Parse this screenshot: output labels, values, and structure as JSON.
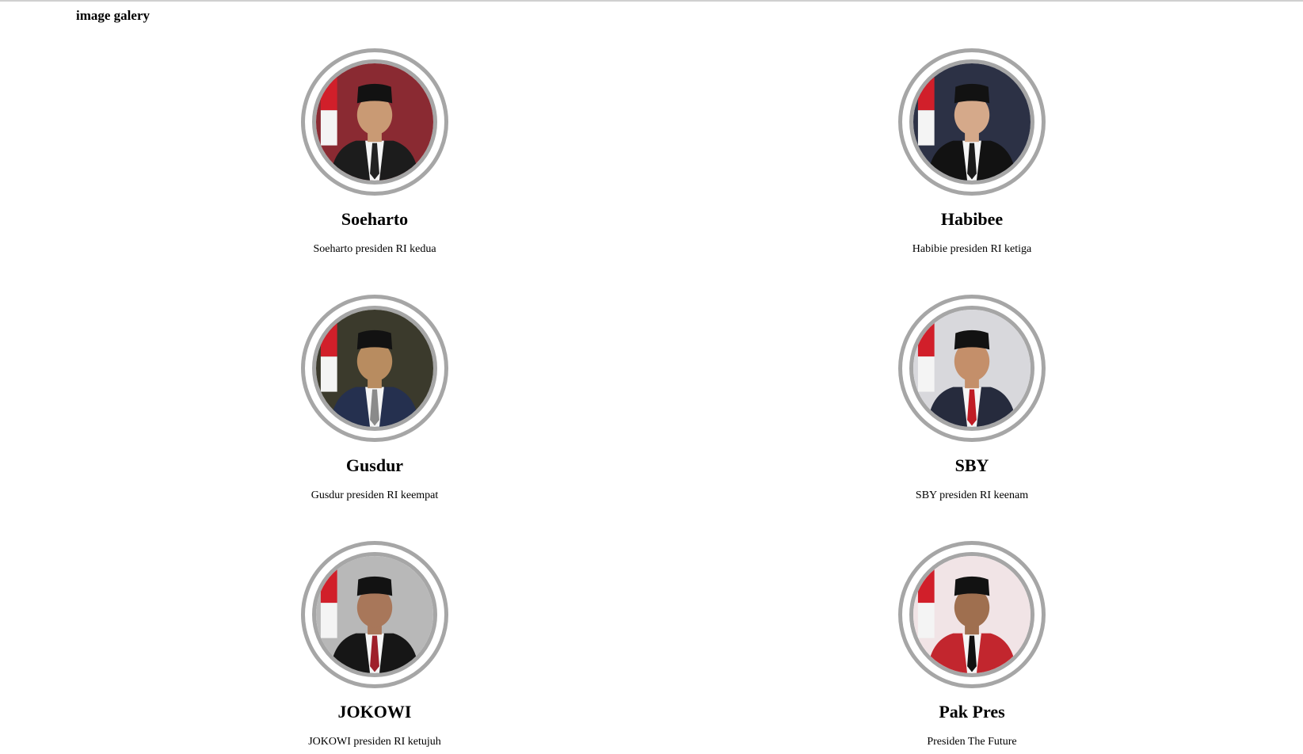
{
  "page": {
    "title": "image galery"
  },
  "gallery": [
    {
      "name": "Soeharto",
      "caption": "Soeharto presiden RI kedua",
      "photo": "portrait-soeharto",
      "bg": "#8a2a32",
      "suit": "#1c1c1c",
      "tie": "#222222",
      "skin": "#c99a74"
    },
    {
      "name": "Habibee",
      "caption": "Habibie presiden RI ketiga",
      "photo": "portrait-habibie",
      "bg": "#2c3145",
      "suit": "#121212",
      "tie": "#1a1a1a",
      "skin": "#d5a98a"
    },
    {
      "name": "Gusdur",
      "caption": "Gusdur presiden RI keempat",
      "photo": "portrait-gusdur",
      "bg": "#3b3a2c",
      "suit": "#25304f",
      "tie": "#8a8a8a",
      "skin": "#b88c60"
    },
    {
      "name": "SBY",
      "caption": "SBY presiden RI keenam",
      "photo": "portrait-sby",
      "bg": "#d8d8dc",
      "suit": "#262b3d",
      "tie": "#c01c25",
      "skin": "#c48f6a"
    },
    {
      "name": "JOKOWI",
      "caption": "JOKOWI presiden RI ketujuh",
      "photo": "portrait-jokowi",
      "bg": "#b8b8b8",
      "suit": "#161616",
      "tie": "#9e1f2a",
      "skin": "#a8775a"
    },
    {
      "name": "Pak Pres",
      "caption": "Presiden The Future",
      "photo": "portrait-pak-pres",
      "bg": "#f1e4e6",
      "suit": "#c2262e",
      "tie": "#111111",
      "skin": "#9f6f4f"
    }
  ]
}
